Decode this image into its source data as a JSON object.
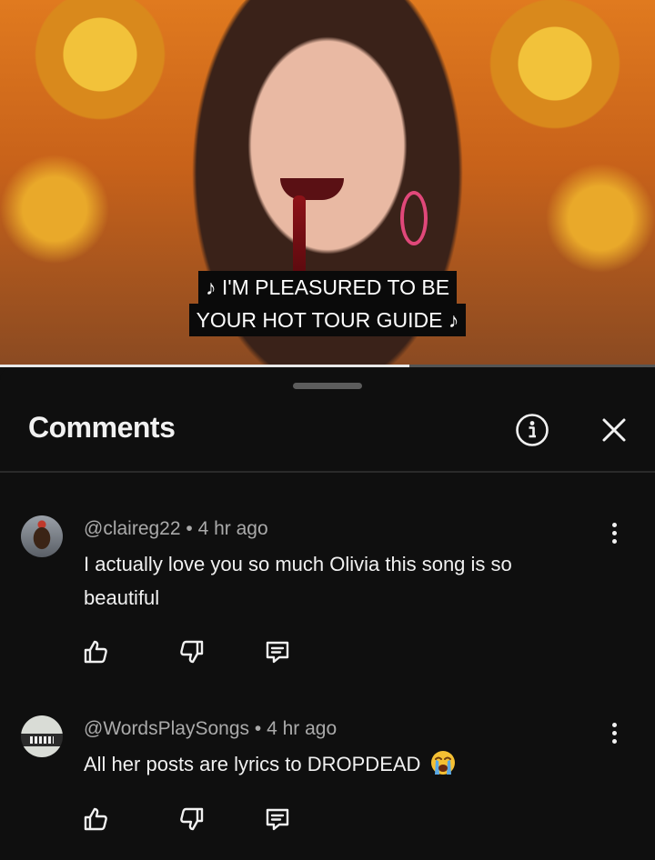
{
  "video": {
    "caption_line1": "♪ I'M PLEASURED TO BE",
    "caption_line2": "YOUR HOT TOUR GUIDE ♪",
    "progress_fraction": 0.625
  },
  "comments_panel": {
    "title": "Comments",
    "info_icon": "info-circle-icon",
    "close_icon": "close-icon"
  },
  "comments": [
    {
      "handle": "@claireg22",
      "separator": "•",
      "time": "4 hr ago",
      "text": "I actually love you so much Olivia this song is so beautiful",
      "emoji": ""
    },
    {
      "handle": "@WordsPlaySongs",
      "separator": "•",
      "time": "4 hr ago",
      "text": "All her posts are lyrics to DROPDEAD",
      "emoji": "loudly-crying-face"
    }
  ],
  "colors": {
    "background": "#0f0f0f",
    "text_primary": "#f1f1f1",
    "text_secondary": "#aaaaaa"
  }
}
